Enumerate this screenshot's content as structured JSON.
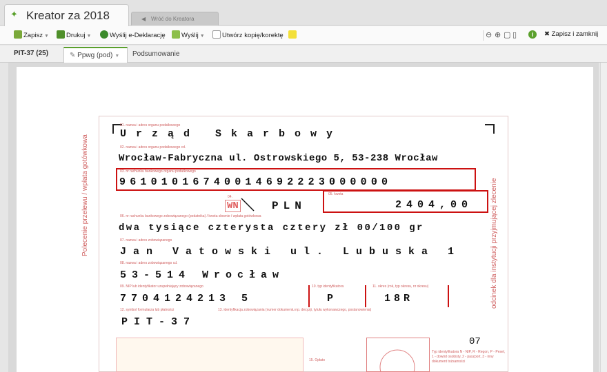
{
  "window": {
    "title": "Kreator za 2018",
    "back_tab": "Wróć do Kreatora"
  },
  "toolbar": {
    "save": "Zapisz",
    "print": "Drukuj",
    "send_edeclaration": "Wyślij e-Deklarację",
    "send": "Wyślij",
    "create_copy": "Utwórz kopię/korektę",
    "save_close": "Zapisz i zamknij"
  },
  "sections": {
    "pit": "PIT-37 (25)",
    "ppwg": "Ppwg (pod)",
    "summary": "Podsumowanie"
  },
  "form": {
    "labels": {
      "f01": "01. nazwa i adres organu podatkowego",
      "f02": "02. nazwa i adres organu podatkowego cd.",
      "f03": "03. nr rachunku bankowego organu podatkowego",
      "f04": "04.",
      "f05": "05. kwota",
      "f06": "06. nr rachunku bankowego zobowiązanego (podatnika) / kwota słownie / wpłata gotówkowa",
      "f07": "07. nazwa i adres zobowiązanego",
      "f08": "08. nazwa i adres zobowiązanego cd.",
      "f09": "09. NIP lub identyfikator uzupełniający zobowiązanego",
      "f10": "10. typ identyfikatora",
      "f11": "11. okres (rok, typ okresu, nr okresu)",
      "f12": "12. symbol formularza lub płatności",
      "f13": "13. identyfikacja zobowiązania (numer dokumentu np. decyzji, tytułu wykonawczego, postanowienia)",
      "f15": "15. Opłato",
      "side_left": "Polecenie przelewu / wpłata gotówkowa",
      "side_right": "odcinek dla instytucji przyjmującej zlecenie",
      "legend": "Typ identyfikatora N - NIP, R - Regon, P - Pesel, 1 - dowód osobisty, 2 - paszport, 3 - inny dokument tożsamości"
    },
    "recipient": "Urząd Skarbowy",
    "recipient_address": "Wrocław-Fabryczna ul. Ostrowskiego 5, 53-238 Wrocław",
    "account": "96101016740014692223000000",
    "currency_marker": "WN",
    "currency": "PLN",
    "amount": "2404,00",
    "amount_words": "dwa tysiące czterysta cztery zł 00/100 gr",
    "payer": "Jan Vatowski ul. Lubuska 1",
    "payer_city": "53-514 Wrocław",
    "nip": "7704124213 5",
    "id_type": "P",
    "period": "18R",
    "symbol": "PIT-37",
    "page_number": "07"
  }
}
